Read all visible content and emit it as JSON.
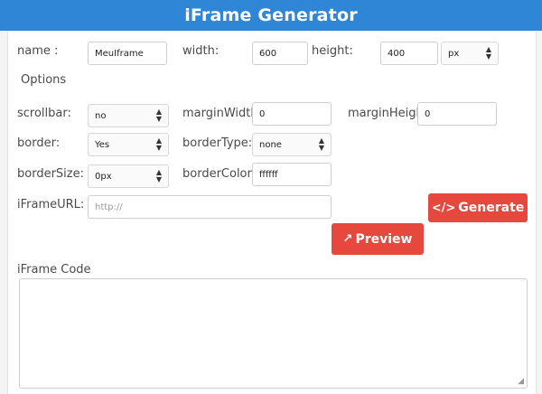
{
  "header": {
    "title": "iFrame Generator"
  },
  "form": {
    "name": {
      "label": "name :",
      "value": "MeuIframe"
    },
    "width": {
      "label": "width:",
      "value": "600"
    },
    "height": {
      "label": "height:",
      "value": "400"
    },
    "unit": {
      "value": "px"
    },
    "options_label": "Options",
    "scrollbar": {
      "label": "scrollbar:",
      "value": "no"
    },
    "marginWidth": {
      "label": "marginWidth:",
      "value": "0"
    },
    "marginHeight": {
      "label": "marginHeight",
      "value": "0"
    },
    "border": {
      "label": "border:",
      "value": "Yes"
    },
    "borderType": {
      "label": "borderType:",
      "value": "none"
    },
    "borderSize": {
      "label": "borderSize:",
      "value": "0px"
    },
    "borderColor": {
      "label": "borderColor:",
      "value": "ffffff"
    },
    "iframeURL": {
      "label": "iFrameURL:",
      "placeholder": "http://"
    }
  },
  "buttons": {
    "generate": "Generate",
    "preview": "Preview"
  },
  "icons": {
    "generate": "code-icon",
    "preview": "external-link-icon"
  },
  "code": {
    "label": "iFrame Code",
    "value": ""
  },
  "colors": {
    "header": "#2f86d6",
    "button": "#e7483d"
  }
}
